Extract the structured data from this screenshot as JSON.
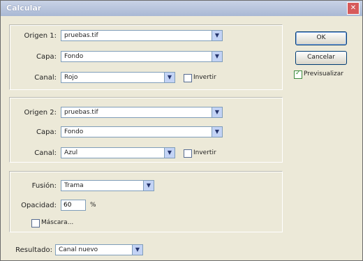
{
  "window": {
    "title": "Calcular"
  },
  "source1": {
    "label": "Origen 1:",
    "file": "pruebas.tif",
    "layer_label": "Capa:",
    "layer": "Fondo",
    "channel_label": "Canal:",
    "channel": "Rojo",
    "invert_label": "Invertir",
    "invert_checked": false
  },
  "source2": {
    "label": "Origen 2:",
    "file": "pruebas.tif",
    "layer_label": "Capa:",
    "layer": "Fondo",
    "channel_label": "Canal:",
    "channel": "Azul",
    "invert_label": "Invertir",
    "invert_checked": false
  },
  "blend": {
    "mode_label": "Fusión:",
    "mode": "Trama",
    "opacity_label": "Opacidad:",
    "opacity": "60",
    "opacity_unit": "%",
    "mask_label": "Máscara...",
    "mask_checked": false
  },
  "result": {
    "label": "Resultado:",
    "value": "Canal nuevo"
  },
  "buttons": {
    "ok": "OK",
    "cancel": "Cancelar",
    "preview_label": "Previsualizar",
    "preview_checked": true
  }
}
